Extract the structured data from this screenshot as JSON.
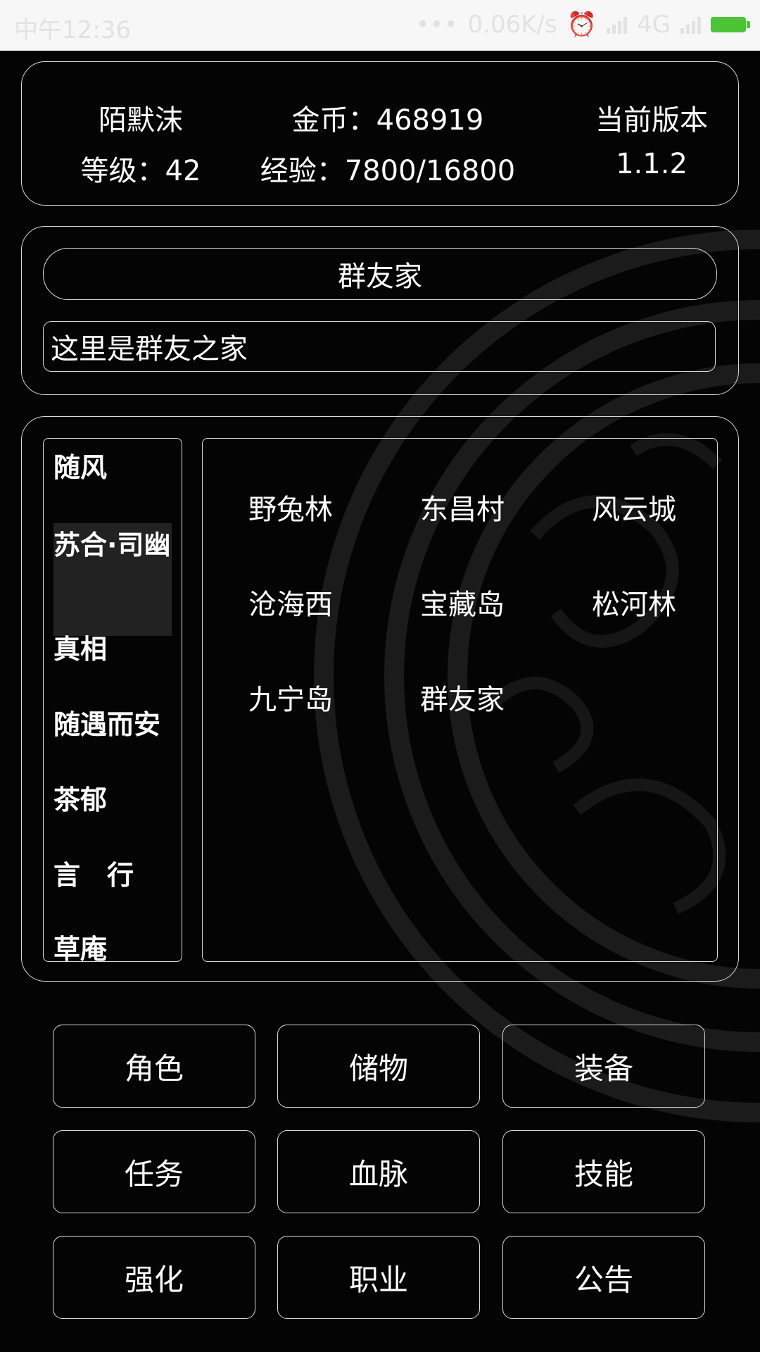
{
  "status_bar": {
    "time": "中午12:36",
    "net_speed": "0.06K/s",
    "network": "4G",
    "colors": {
      "bg": "#f7f7f7",
      "battery": "#4cc436"
    }
  },
  "info": {
    "player_name": "陌默沫",
    "level": "等级：42",
    "gold": "金币：468919",
    "exp": "经验：7800/16800",
    "version_label": "当前版本",
    "version": "1.1.2"
  },
  "location": {
    "title": "群友家",
    "description": "这里是群友之家"
  },
  "players": [
    "随风",
    "苏合·司幽",
    "真相",
    "随遇而安",
    "茶郁",
    "言　行",
    "草庵"
  ],
  "zones": [
    "野兔林",
    "东昌村",
    "风云城",
    "沧海西",
    "宝藏岛",
    "松河林",
    "九宁岛",
    "群友家"
  ],
  "menu": [
    "角色",
    "储物",
    "装备",
    "任务",
    "血脉",
    "技能",
    "强化",
    "职业",
    "公告"
  ]
}
